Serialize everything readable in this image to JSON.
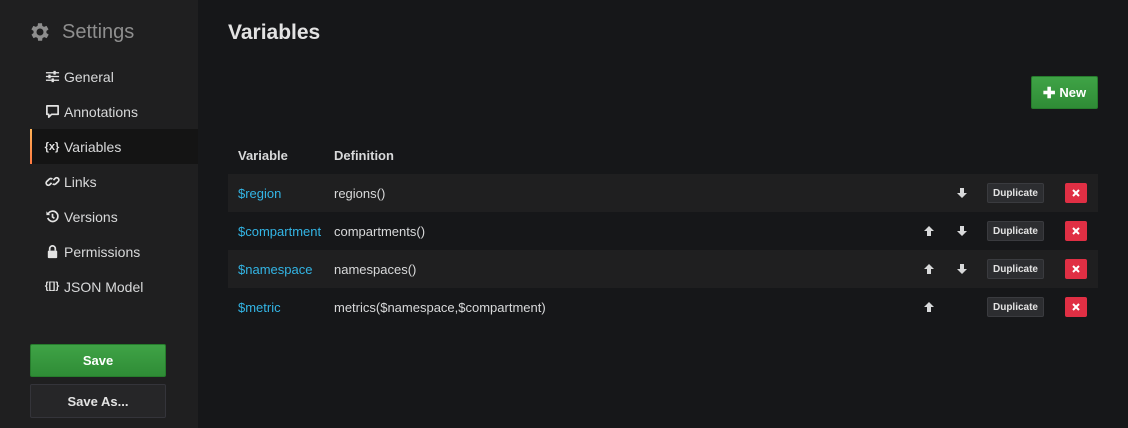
{
  "sidebar": {
    "title": "Settings",
    "items": [
      {
        "label": "General",
        "icon": "sliders-icon",
        "active": false
      },
      {
        "label": "Annotations",
        "icon": "comment-icon",
        "active": false
      },
      {
        "label": "Variables",
        "icon": "variable-icon",
        "active": true
      },
      {
        "label": "Links",
        "icon": "link-icon",
        "active": false
      },
      {
        "label": "Versions",
        "icon": "history-icon",
        "active": false
      },
      {
        "label": "Permissions",
        "icon": "lock-icon",
        "active": false
      },
      {
        "label": "JSON Model",
        "icon": "json-icon",
        "active": false
      }
    ],
    "variable_glyph": "{x}",
    "json_glyph": "{[]}",
    "save_label": "Save",
    "save_as_label": "Save As..."
  },
  "main": {
    "title": "Variables",
    "new_button_label": "New",
    "table": {
      "headers": {
        "variable": "Variable",
        "definition": "Definition"
      },
      "rows": [
        {
          "name": "$region",
          "definition": "regions()",
          "can_move_up": false,
          "can_move_down": true
        },
        {
          "name": "$compartment",
          "definition": "compartments()",
          "can_move_up": true,
          "can_move_down": true
        },
        {
          "name": "$namespace",
          "definition": "namespaces()",
          "can_move_up": true,
          "can_move_down": true
        },
        {
          "name": "$metric",
          "definition": "metrics($namespace,$compartment)",
          "can_move_up": true,
          "can_move_down": false
        }
      ],
      "duplicate_label": "Duplicate"
    }
  },
  "colors": {
    "accent_green": "#3fa346",
    "danger_red": "#e02f44",
    "link_blue": "#33b5e5",
    "active_marker": "#ff7941"
  }
}
